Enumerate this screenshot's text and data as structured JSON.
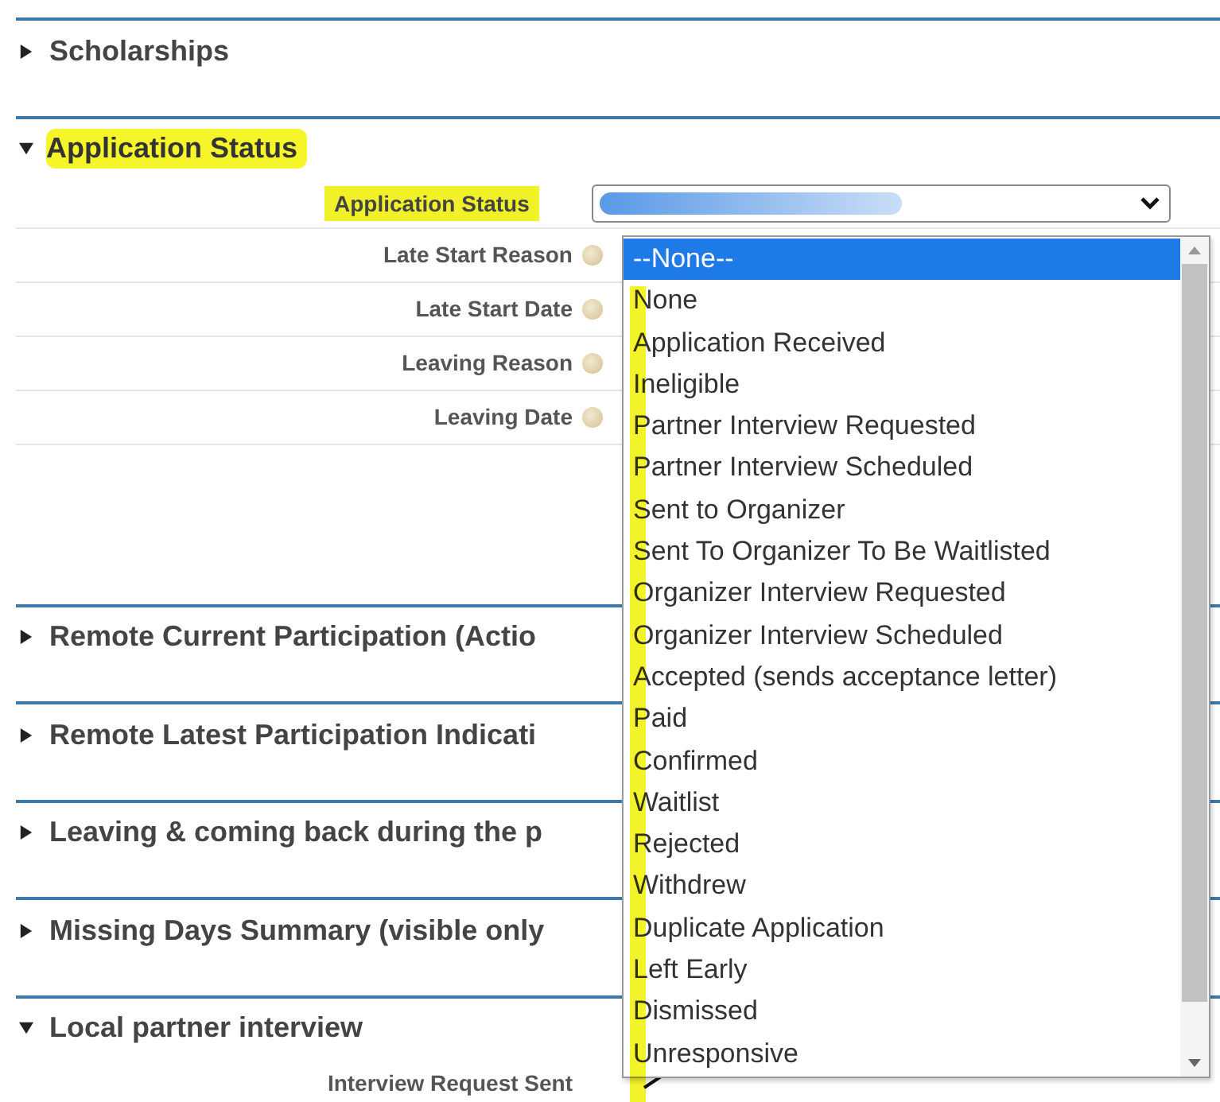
{
  "sections": [
    {
      "title": "Scholarships",
      "expanded": false,
      "highlighted": false
    },
    {
      "title": "Application Status",
      "expanded": true,
      "highlighted": true,
      "fields": [
        {
          "label": "Application Status",
          "highlighted": true,
          "help": false,
          "kind": "select"
        },
        {
          "label": "Late Start Reason",
          "highlighted": false,
          "help": true,
          "kind": "text"
        },
        {
          "label": "Late Start Date",
          "highlighted": false,
          "help": true,
          "kind": "text"
        },
        {
          "label": "Leaving Reason",
          "highlighted": false,
          "help": true,
          "kind": "text"
        },
        {
          "label": "Leaving Date",
          "highlighted": false,
          "help": true,
          "kind": "text"
        }
      ]
    },
    {
      "title": "Remote Current Participation (Actio",
      "expanded": false,
      "highlighted": false
    },
    {
      "title": "Remote Latest Participation Indicati",
      "expanded": false,
      "highlighted": false
    },
    {
      "title": "Leaving & coming back during the p",
      "expanded": false,
      "highlighted": false
    },
    {
      "title": "Missing Days Summary (visible only",
      "expanded": false,
      "highlighted": false
    },
    {
      "title": "Local partner interview",
      "expanded": true,
      "highlighted": false,
      "fields": [
        {
          "label": "Interview Request Sent",
          "highlighted": false,
          "help": false,
          "kind": "checkbox",
          "checked": true
        }
      ]
    }
  ],
  "dropdown": {
    "options": [
      {
        "label": "--None--",
        "selected": true
      },
      {
        "label": "None",
        "selected": false
      },
      {
        "label": "Application Received",
        "selected": false
      },
      {
        "label": "Ineligible",
        "selected": false
      },
      {
        "label": "Partner Interview Requested",
        "selected": false
      },
      {
        "label": "Partner Interview Scheduled",
        "selected": false
      },
      {
        "label": "Sent to Organizer",
        "selected": false
      },
      {
        "label": "Sent To Organizer To Be Waitlisted",
        "selected": false
      },
      {
        "label": "Organizer Interview Requested",
        "selected": false
      },
      {
        "label": "Organizer Interview Scheduled",
        "selected": false
      },
      {
        "label": "Accepted (sends acceptance letter)",
        "selected": false
      },
      {
        "label": "Paid",
        "selected": false
      },
      {
        "label": "Confirmed",
        "selected": false
      },
      {
        "label": "Waitlist",
        "selected": false
      },
      {
        "label": "Rejected",
        "selected": false
      },
      {
        "label": "Withdrew",
        "selected": false
      },
      {
        "label": "Duplicate Application",
        "selected": false
      },
      {
        "label": "Left Early",
        "selected": false
      },
      {
        "label": "Dismissed",
        "selected": false
      },
      {
        "label": "Unresponsive",
        "selected": false
      }
    ]
  }
}
